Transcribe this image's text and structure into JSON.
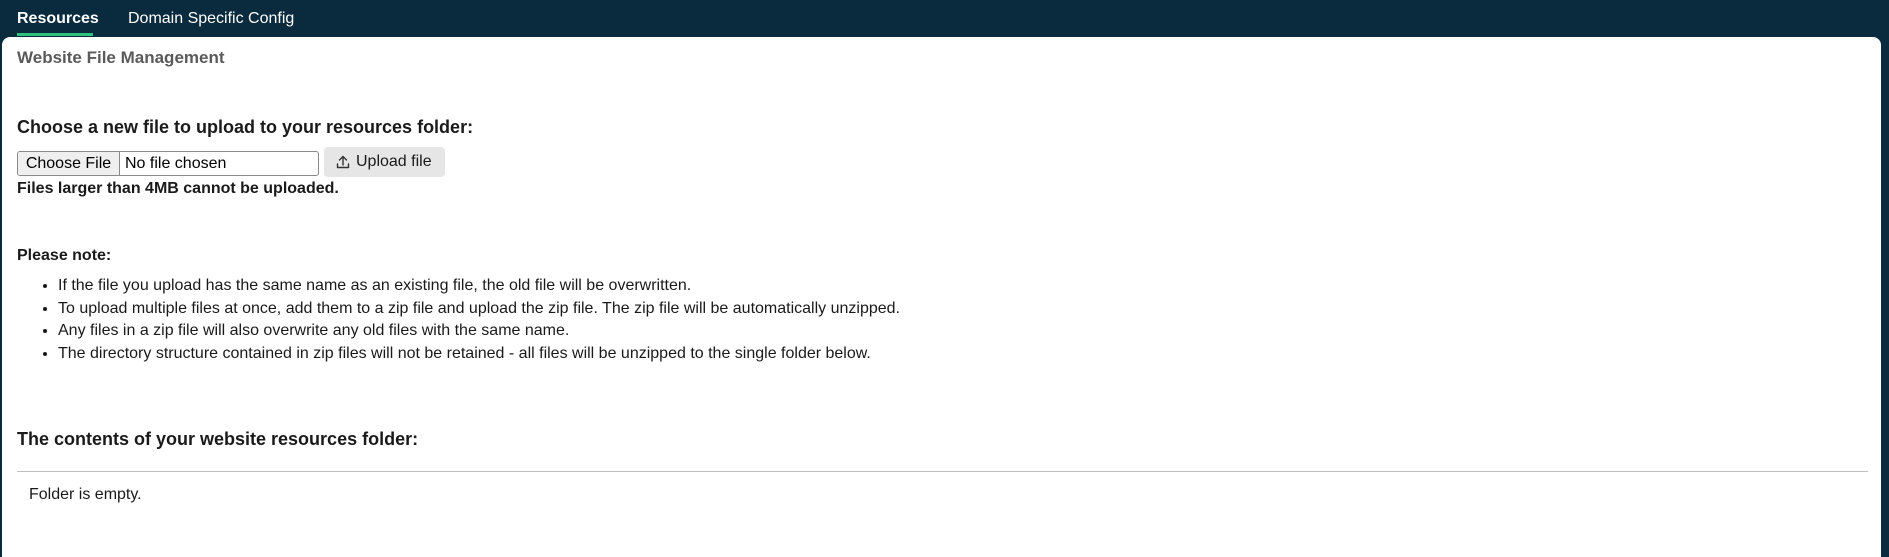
{
  "tabs": {
    "resources": "Resources",
    "domain_specific_config": "Domain Specific Config"
  },
  "colors": {
    "header_bg": "#0a2b3d",
    "active_tab_underline": "#2ec27e"
  },
  "panel": {
    "title": "Website File Management"
  },
  "upload": {
    "heading": "Choose a new file to upload to your resources folder:",
    "choose_file_label": "Choose File",
    "file_status": "No file chosen",
    "upload_button_label": "Upload file",
    "upload_icon": "upload-icon",
    "size_warning": "Files larger than 4MB cannot be uploaded."
  },
  "notes": {
    "heading": "Please note:",
    "items": [
      "If the file you upload has the same name as an existing file, the old file will be overwritten.",
      "To upload multiple files at once, add them to a zip file and upload the zip file. The zip file will be automatically unzipped.",
      "Any files in a zip file will also overwrite any old files with the same name.",
      "The directory structure contained in zip files will not be retained - all files will be unzipped to the single folder below."
    ]
  },
  "contents": {
    "heading": "The contents of your website resources folder:",
    "empty_message": "Folder is empty."
  }
}
